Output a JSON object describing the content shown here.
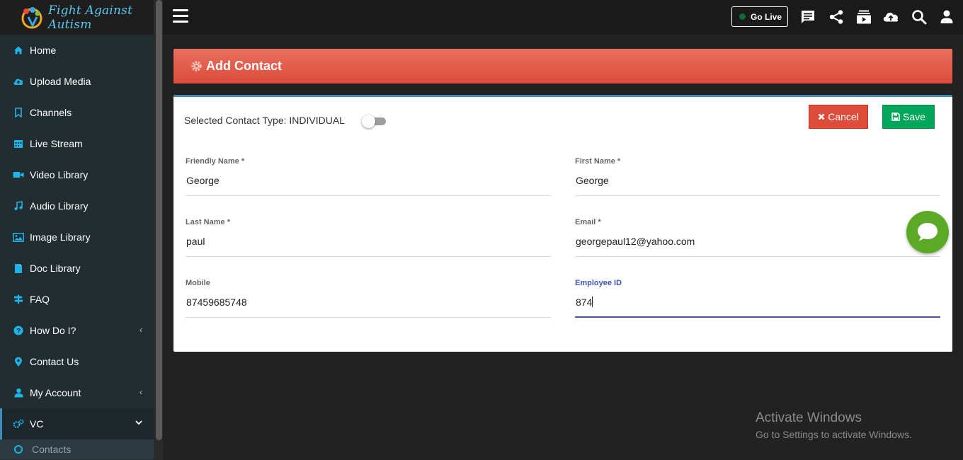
{
  "app": {
    "title": "Fight Against Autism"
  },
  "sidebar": {
    "items": [
      {
        "label": "Home",
        "icon": "home-icon"
      },
      {
        "label": "Upload Media",
        "icon": "cloud-upload-icon"
      },
      {
        "label": "Channels",
        "icon": "bookmark-icon"
      },
      {
        "label": "Live Stream",
        "icon": "calendar-icon"
      },
      {
        "label": "Video Library",
        "icon": "video-icon"
      },
      {
        "label": "Audio Library",
        "icon": "music-icon"
      },
      {
        "label": "Image Library",
        "icon": "image-icon"
      },
      {
        "label": "Doc Library",
        "icon": "document-icon"
      },
      {
        "label": "FAQ",
        "icon": "signpost-icon"
      },
      {
        "label": "How Do I?",
        "icon": "question-icon"
      },
      {
        "label": "Contact Us",
        "icon": "map-marker-icon"
      },
      {
        "label": "My Account",
        "icon": "user-icon"
      },
      {
        "label": "VC",
        "icon": "cogs-icon"
      }
    ],
    "sub": {
      "label": "Contacts"
    },
    "chevron": "‹",
    "chevron_open": "⌄"
  },
  "topbar": {
    "go_live": "Go Live",
    "icons": [
      "chat-icon",
      "share-icon",
      "playlist-icon",
      "cloud-upload-icon",
      "search-icon",
      "user-icon"
    ]
  },
  "page": {
    "title": "Add Contact"
  },
  "form": {
    "contact_type_label": "Selected Contact Type: INDIVIDUAL",
    "toggle_on": false,
    "cancel_label": "Cancel",
    "save_label": "Save",
    "fields": {
      "friendly_name": {
        "label": "Friendly Name *",
        "value": "George"
      },
      "first_name": {
        "label": "First Name *",
        "value": "George"
      },
      "last_name": {
        "label": "Last Name *",
        "value": "paul"
      },
      "email": {
        "label": "Email *",
        "value": "georgepaul12@yahoo.com"
      },
      "mobile": {
        "label": "Mobile",
        "value": "87459685748"
      },
      "employee_id": {
        "label": "Employee ID",
        "value": "874"
      }
    }
  },
  "watermark": {
    "line1": "Activate Windows",
    "line2": "Go to Settings to activate Windows."
  },
  "colors": {
    "accent": "#3c8dbc",
    "banner": "#dd4b39",
    "cancel": "#dd4b39",
    "save": "#00a65a",
    "focus": "#3f51b5",
    "chat": "#5aaa26"
  }
}
